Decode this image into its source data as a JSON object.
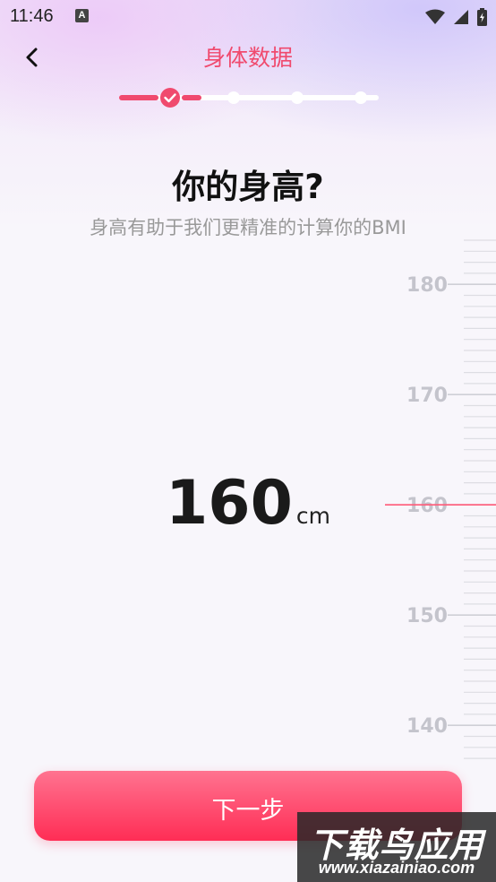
{
  "status_bar": {
    "time": "11:46",
    "notification_letter": "A"
  },
  "header": {
    "title": "身体数据",
    "back_icon": "chevron-left-icon"
  },
  "stepper": {
    "total_steps": 5,
    "completed_steps": 1
  },
  "question": {
    "title": "你的身高?",
    "subtitle": "身高有助于我们更精准的计算你的BMI"
  },
  "height": {
    "value": "160",
    "unit": "cm"
  },
  "ruler": {
    "labels": [
      "180",
      "170",
      "160",
      "150",
      "140"
    ],
    "selected": 160
  },
  "actions": {
    "next_label": "下一步"
  },
  "watermark": {
    "main": "下载鸟应用",
    "sub": "www.xiazainiao.com"
  },
  "colors": {
    "accent": "#f04a6e",
    "button": "#ff2d55",
    "marker": "#ff5a78"
  }
}
